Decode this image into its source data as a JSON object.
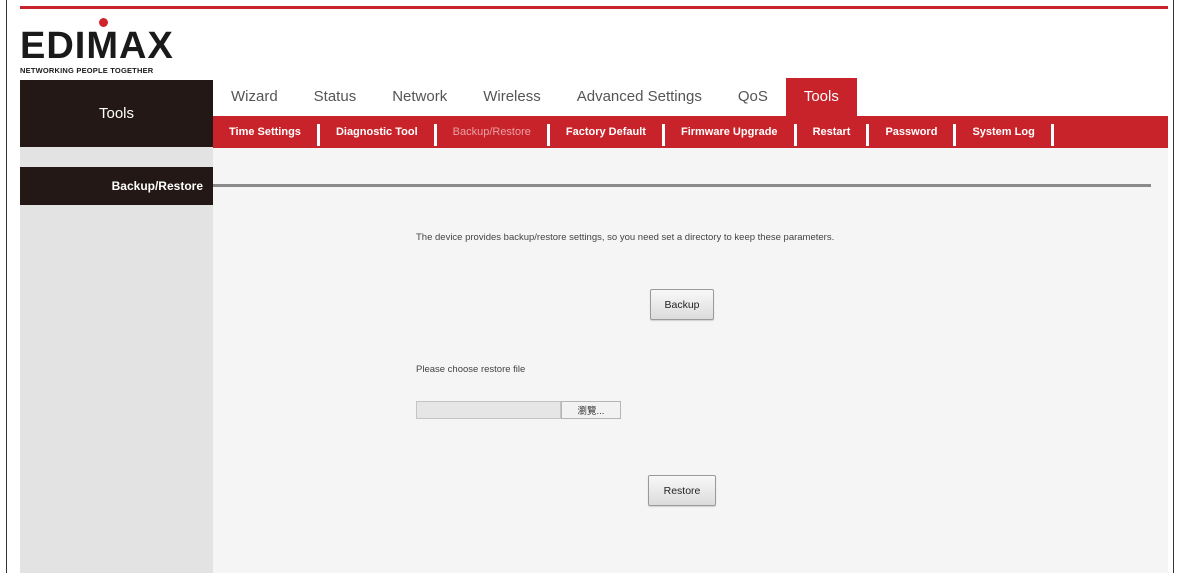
{
  "logo": {
    "brand": "EDIMAX",
    "tagline": "NETWORKING PEOPLE TOGETHER"
  },
  "sidebar": {
    "header": "Tools",
    "items": [
      {
        "label": "Backup/Restore",
        "active": true
      }
    ]
  },
  "main_tabs": [
    {
      "label": "Wizard",
      "active": false
    },
    {
      "label": "Status",
      "active": false
    },
    {
      "label": "Network",
      "active": false
    },
    {
      "label": "Wireless",
      "active": false
    },
    {
      "label": "Advanced Settings",
      "active": false
    },
    {
      "label": "QoS",
      "active": false
    },
    {
      "label": "Tools",
      "active": true
    }
  ],
  "sub_nav": [
    {
      "label": "Time Settings",
      "active": false
    },
    {
      "label": "Diagnostic Tool",
      "active": false
    },
    {
      "label": "Backup/Restore",
      "active": true
    },
    {
      "label": "Factory Default",
      "active": false
    },
    {
      "label": "Firmware Upgrade",
      "active": false
    },
    {
      "label": "Restart",
      "active": false
    },
    {
      "label": "Password",
      "active": false
    },
    {
      "label": "System Log",
      "active": false
    }
  ],
  "content": {
    "description": "The device provides backup/restore settings, so you need set a directory to keep these parameters.",
    "backup_button": "Backup",
    "restore_prompt": "Please choose restore file",
    "file_input_value": "",
    "browse_button": "瀏覽...",
    "restore_button": "Restore"
  },
  "colors": {
    "brand_red": "#c8232a",
    "dark_panel": "#231815",
    "side_gray": "#e3e3e3"
  }
}
